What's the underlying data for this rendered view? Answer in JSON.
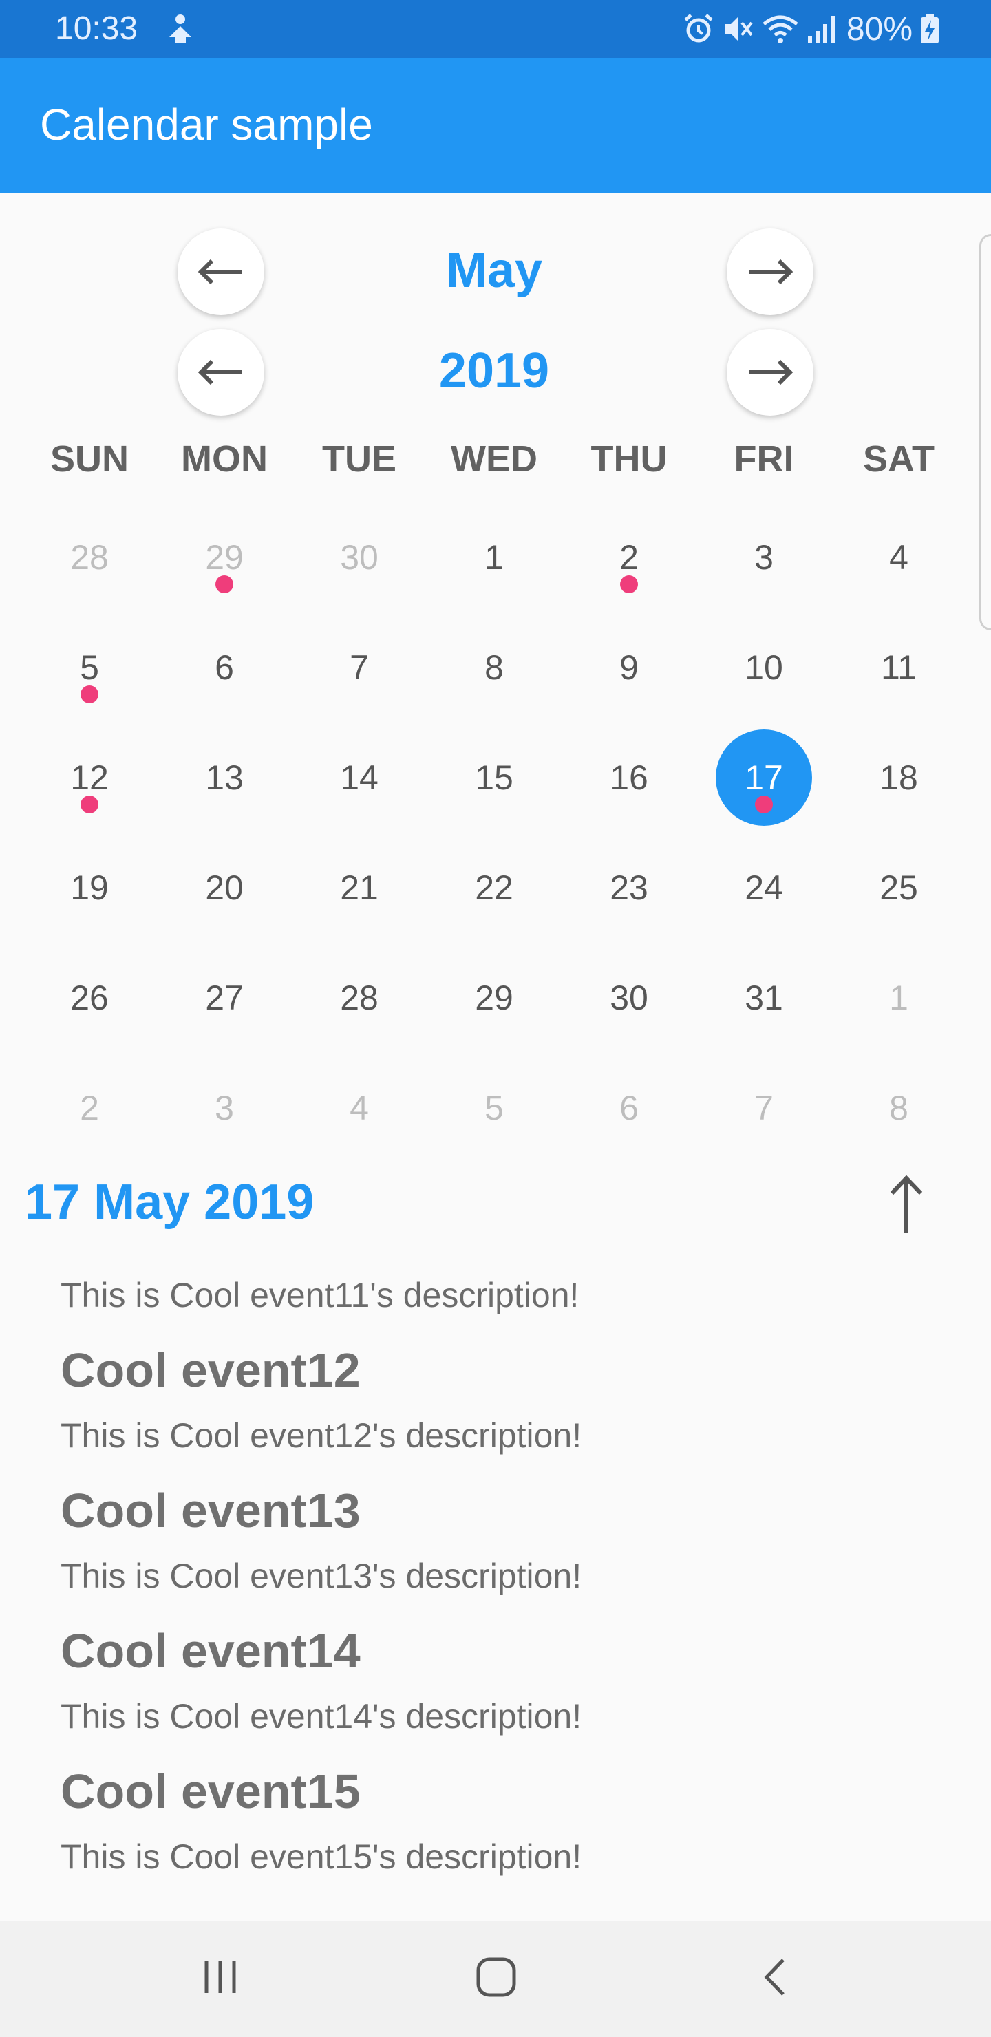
{
  "status_bar": {
    "time": "10:33",
    "battery": "80%"
  },
  "app_bar": {
    "title": "Calendar sample"
  },
  "calendar": {
    "month": "May",
    "year": "2019",
    "weekdays": [
      "SUN",
      "MON",
      "TUE",
      "WED",
      "THU",
      "FRI",
      "SAT"
    ],
    "weeks": [
      [
        {
          "d": "28",
          "o": true
        },
        {
          "d": "29",
          "o": true,
          "e": true
        },
        {
          "d": "30",
          "o": true
        },
        {
          "d": "1"
        },
        {
          "d": "2",
          "e": true
        },
        {
          "d": "3"
        },
        {
          "d": "4"
        }
      ],
      [
        {
          "d": "5",
          "e": true
        },
        {
          "d": "6"
        },
        {
          "d": "7"
        },
        {
          "d": "8"
        },
        {
          "d": "9"
        },
        {
          "d": "10"
        },
        {
          "d": "11"
        }
      ],
      [
        {
          "d": "12",
          "e": true
        },
        {
          "d": "13"
        },
        {
          "d": "14"
        },
        {
          "d": "15"
        },
        {
          "d": "16"
        },
        {
          "d": "17",
          "s": true,
          "e": true
        },
        {
          "d": "18"
        }
      ],
      [
        {
          "d": "19"
        },
        {
          "d": "20"
        },
        {
          "d": "21"
        },
        {
          "d": "22"
        },
        {
          "d": "23"
        },
        {
          "d": "24"
        },
        {
          "d": "25"
        }
      ],
      [
        {
          "d": "26"
        },
        {
          "d": "27"
        },
        {
          "d": "28"
        },
        {
          "d": "29"
        },
        {
          "d": "30"
        },
        {
          "d": "31"
        },
        {
          "d": "1",
          "o": true
        }
      ],
      [
        {
          "d": "2",
          "o": true
        },
        {
          "d": "3",
          "o": true
        },
        {
          "d": "4",
          "o": true
        },
        {
          "d": "5",
          "o": true
        },
        {
          "d": "6",
          "o": true
        },
        {
          "d": "7",
          "o": true
        },
        {
          "d": "8",
          "o": true
        }
      ]
    ],
    "colors": {
      "accent": "#2196f3",
      "event_dot": "#ef3d7b"
    }
  },
  "selected_date": "17 May 2019",
  "events": {
    "first_description": "This is Cool event11's description!",
    "items": [
      {
        "title": "Cool event12",
        "description": "This is Cool event12's description!"
      },
      {
        "title": "Cool event13",
        "description": "This is Cool event13's description!"
      },
      {
        "title": "Cool event14",
        "description": "This is Cool event14's description!"
      },
      {
        "title": "Cool event15",
        "description": "This is Cool event15's description!"
      }
    ]
  }
}
